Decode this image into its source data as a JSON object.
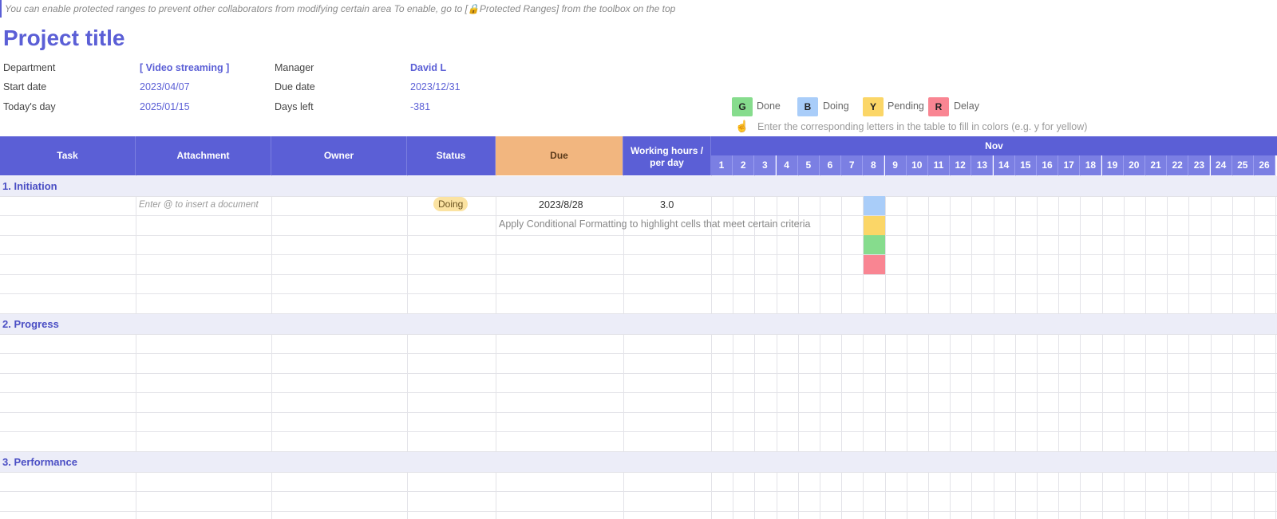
{
  "tip": "You can enable protected ranges to prevent other collaborators from modifying certain area To enable, go to [🔒Protected Ranges] from the toolbox on the top",
  "title": "Project title",
  "info": {
    "department_label": "Department",
    "department_value": "[ Video streaming ]",
    "manager_label": "Manager",
    "manager_value": "David L",
    "start_label": "Start date",
    "start_value": "2023/04/07",
    "due_label": "Due date",
    "due_value": "2023/12/31",
    "today_label": "Today's day",
    "today_value": "2025/01/15",
    "daysleft_label": "Days left",
    "daysleft_value": "-381"
  },
  "legend": {
    "items": [
      {
        "letter": "G",
        "label": "Done",
        "color": "#86dc8d"
      },
      {
        "letter": "B",
        "label": "Doing",
        "color": "#a9cdf9"
      },
      {
        "letter": "Y",
        "label": "Pending",
        "color": "#fbd667"
      },
      {
        "letter": "R",
        "label": "Delay",
        "color": "#f98592"
      }
    ],
    "hint": "Enter the corresponding letters in the table to fill in colors (e.g. y for yellow)",
    "hand_icon": "pointing-hand-icon"
  },
  "headers": {
    "task": "Task",
    "attachment": "Attachment",
    "owner": "Owner",
    "status": "Status",
    "due": "Due",
    "working_hours": "Working hours / per day",
    "month": "Nov"
  },
  "days": [
    "1",
    "2",
    "3",
    "4",
    "5",
    "6",
    "7",
    "8",
    "9",
    "10",
    "11",
    "12",
    "13",
    "14",
    "15",
    "16",
    "17",
    "18",
    "19",
    "20",
    "21",
    "22",
    "23",
    "24",
    "25",
    "26"
  ],
  "sections": [
    {
      "label": "1. Initiation"
    },
    {
      "label": "2. Progress"
    },
    {
      "label": "3. Performance"
    }
  ],
  "row1": {
    "attachment_placeholder": "Enter @ to insert a document",
    "status": "Doing",
    "due": "2023/8/28",
    "hours": "3.0"
  },
  "cf_note": "Apply Conditional Formatting to highlight cells that meet certain criteria",
  "colors": {
    "accent": "#5b5fd6",
    "due_header": "#f2b67f",
    "section_bg": "#ecedf8"
  }
}
